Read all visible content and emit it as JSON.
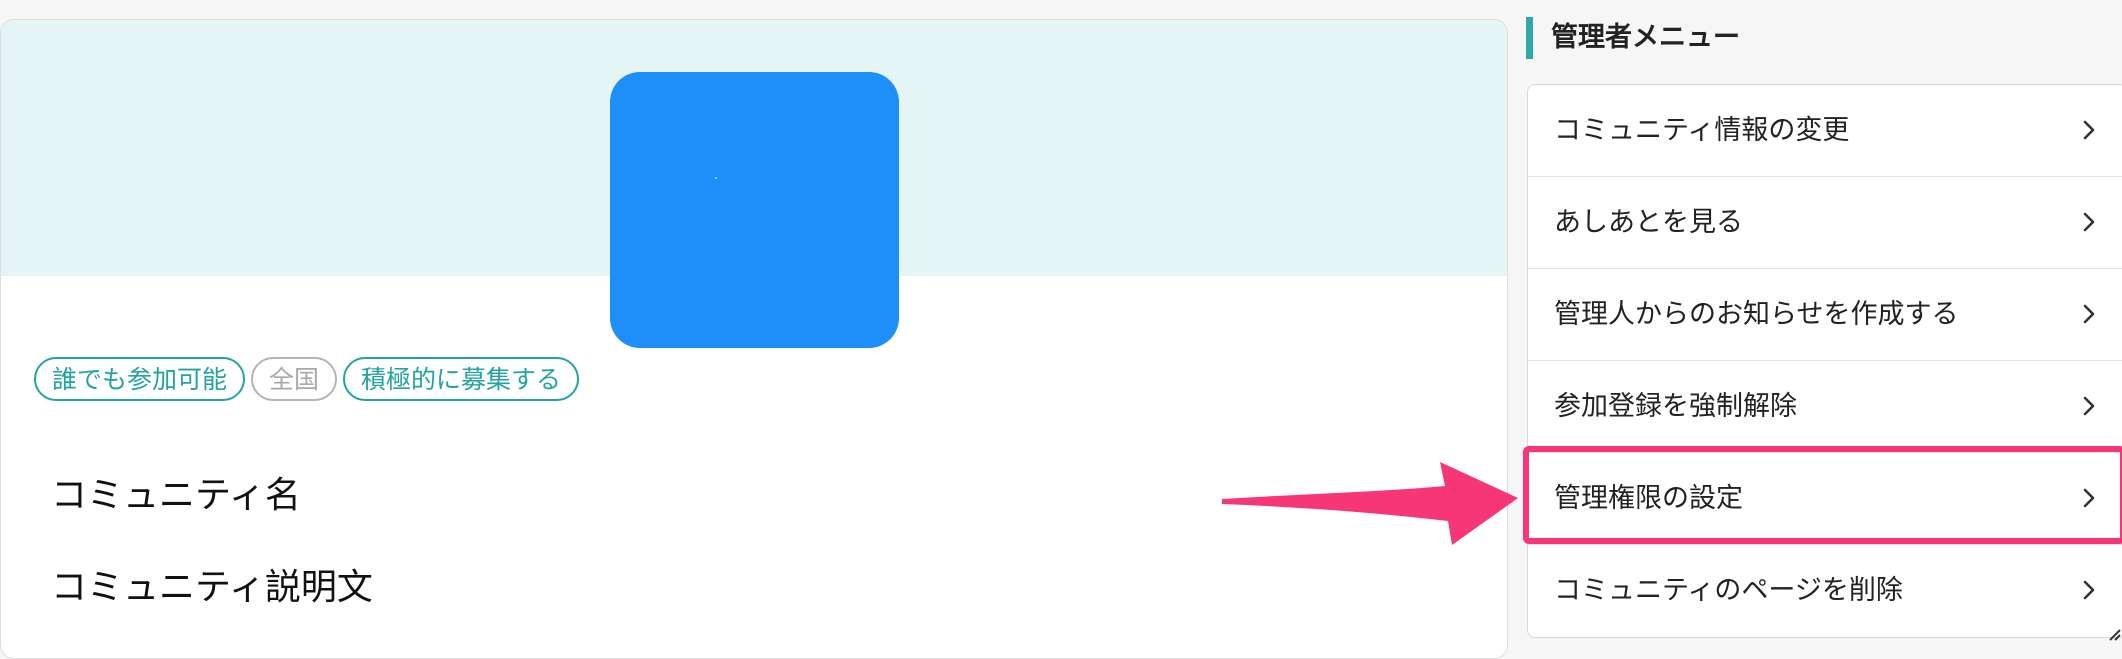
{
  "community": {
    "tags": [
      {
        "label": "誰でも参加可能"
      },
      {
        "label": "全国"
      },
      {
        "label": "積極的に募集する"
      }
    ],
    "name": "コミュニティ名",
    "description": "コミュニティ説明文"
  },
  "admin_menu": {
    "title": "管理者メニュー",
    "items": [
      {
        "label": "コミュニティ情報の変更"
      },
      {
        "label": "あしあとを見る"
      },
      {
        "label": "管理人からのお知らせを作成する"
      },
      {
        "label": "参加登録を強制解除"
      },
      {
        "label": "管理権限の設定"
      },
      {
        "label": "コミュニティのページを削除"
      }
    ]
  },
  "colors": {
    "accent": "#24a3a0",
    "highlight": "#f73677",
    "avatar": "#1e8ef9"
  }
}
